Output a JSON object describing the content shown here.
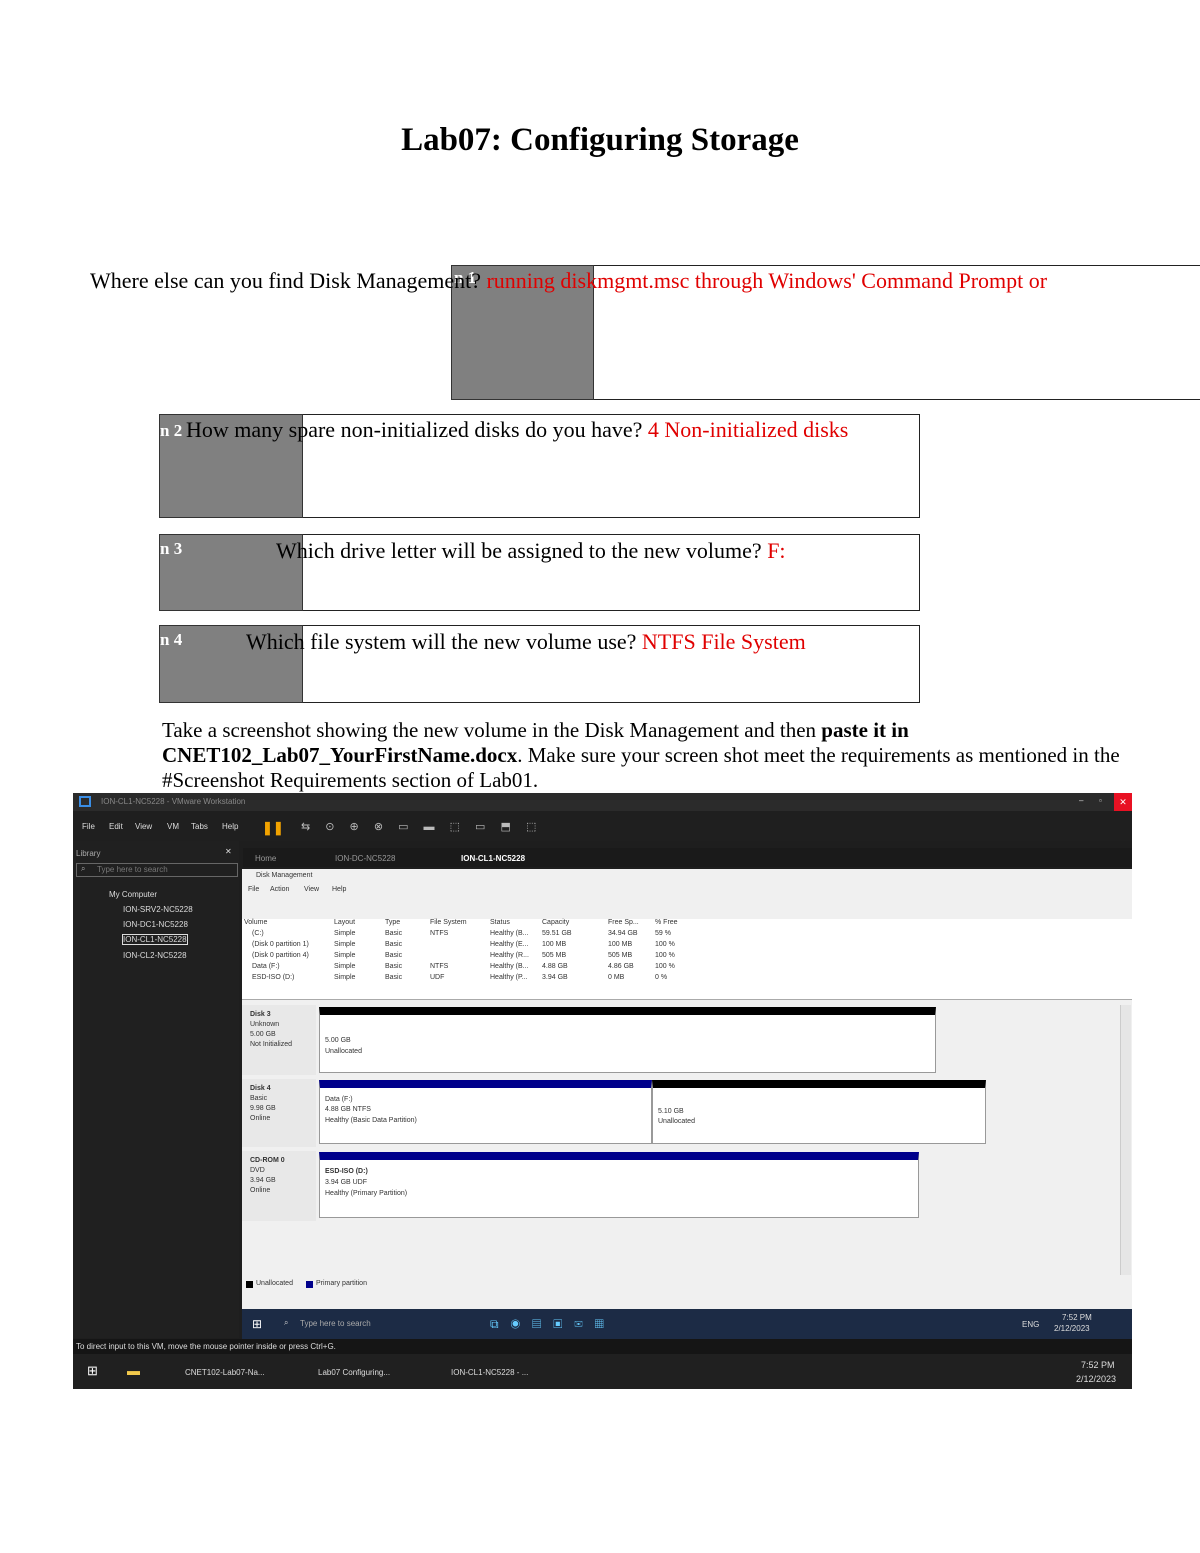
{
  "title": "Lab07: Configuring Storage",
  "q1": {
    "question": "Where else can you find Disk Management?",
    "answer": "running diskmgmt.msc through Windows' Command Prompt or",
    "overlay": "n 1"
  },
  "q2": {
    "label": "n 2",
    "question": "How many spare non-initialized disks do you have?",
    "answer": "4 Non-initialized disks"
  },
  "q3": {
    "label": "n 3",
    "question": "Which drive letter will be assigned to the new volume?",
    "answer": "F:"
  },
  "q4": {
    "label": "n 4",
    "question": "Which file system will the new volume use?",
    "answer": "NTFS File System"
  },
  "instruction": {
    "part1": "Take a screenshot showing the new volume in the Disk Management and then ",
    "bold1": "paste  it in",
    "bold2": "CNET102_Lab07_YourFirstName.docx",
    "part2": ". Make sure your screen shot meet  the requirements as mentioned in the #Screenshot  Requirements section of  Lab01."
  },
  "vmware": {
    "window_title": "ION-CL1-NC5228 - VMware Workstation",
    "menu": [
      "File",
      "Edit",
      "View",
      "VM",
      "Tabs",
      "Help"
    ],
    "library_label": "Library",
    "search_placeholder": "Type here to search",
    "tree_root": "My Computer",
    "tree_items": [
      "ION-SRV2-NC5228",
      "ION-DC1-NC5228",
      "ION-CL1-NC5228",
      "ION-CL2-NC5228"
    ],
    "tabs": [
      "Home",
      "ION-DC-NC5228",
      "ION-CL1-NC5228"
    ],
    "status_hint": "To direct input to this VM, move the mouse pointer inside or press Ctrl+G."
  },
  "disk_mgmt": {
    "title": "Disk Management",
    "menu": [
      "File",
      "Action",
      "View",
      "Help"
    ],
    "columns": [
      "Volume",
      "Layout",
      "Type",
      "File System",
      "Status",
      "Capacity",
      "Free Sp...",
      "% Free"
    ],
    "rows": [
      [
        "(C:)",
        "Simple",
        "Basic",
        "NTFS",
        "Healthy (B...",
        "59.51 GB",
        "34.94 GB",
        "59 %"
      ],
      [
        "(Disk 0 partition 1)",
        "Simple",
        "Basic",
        "",
        "Healthy (E...",
        "100 MB",
        "100 MB",
        "100 %"
      ],
      [
        "(Disk 0 partition 4)",
        "Simple",
        "Basic",
        "",
        "Healthy (R...",
        "505 MB",
        "505 MB",
        "100 %"
      ],
      [
        "Data (F:)",
        "Simple",
        "Basic",
        "NTFS",
        "Healthy (B...",
        "4.88 GB",
        "4.86 GB",
        "100 %"
      ],
      [
        "ESD-ISO (D:)",
        "Simple",
        "Basic",
        "UDF",
        "Healthy (P...",
        "3.94 GB",
        "0 MB",
        "0 %"
      ]
    ],
    "disk3": {
      "name": "Disk 3",
      "l1": "Unknown",
      "l2": "5.00 GB",
      "l3": "Not Initialized",
      "part_size": "5.00 GB",
      "part_status": "Unallocated"
    },
    "disk4": {
      "name": "Disk 4",
      "l1": "Basic",
      "l2": "9.98 GB",
      "l3": "Online",
      "p1_name": "Data  (F:)",
      "p1_size": "4.88 GB NTFS",
      "p1_status": "Healthy (Basic Data Partition)",
      "p2_size": "5.10 GB",
      "p2_status": "Unallocated"
    },
    "cdrom": {
      "name": "CD-ROM 0",
      "l1": "DVD",
      "l2": "3.94 GB",
      "l3": "Online",
      "p_name": "ESD-ISO  (D:)",
      "p_size": "3.94 GB UDF",
      "p_status": "Healthy (Primary Partition)"
    },
    "legend": [
      "Unallocated",
      "Primary partition"
    ]
  },
  "guest_taskbar": {
    "search": "Type here to search",
    "time": "7:52 PM",
    "date": "2/12/2023",
    "lang": "ENG"
  },
  "host_taskbar": {
    "items": [
      "CNET102-Lab07-Na...",
      "Lab07 Configuring...",
      "ION-CL1-NC5228 - ..."
    ],
    "time": "7:52 PM",
    "date": "2/12/2023"
  },
  "colors": {
    "answer": "#e00000",
    "primary_partition": "#00008b",
    "unallocated": "#000000"
  }
}
